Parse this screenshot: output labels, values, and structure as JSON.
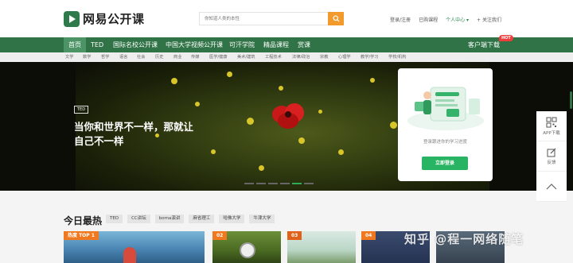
{
  "header": {
    "logo_text": "网易公开课",
    "search_placeholder": "你知道人类的本性",
    "links": [
      "登录/注册",
      "已购课程",
      "个人中心",
      "关注我们"
    ]
  },
  "nav": {
    "items": [
      "首页",
      "TED",
      "国际名校公开课",
      "中国大学视频公开课",
      "可汗学院",
      "精品课程",
      "赏课"
    ],
    "client_download": "客户端下载",
    "hot_badge": "HOT"
  },
  "subnav": {
    "items": [
      "文学",
      "数学",
      "哲学",
      "语言",
      "社会",
      "历史",
      "商业",
      "传媒",
      "医学/健康",
      "美术/建筑",
      "工程技术",
      "法律/政治",
      "宗教",
      "心理学",
      "教学/学习",
      "学校/机构"
    ]
  },
  "hero": {
    "tag": "TED",
    "title_line1": "当你和世界不一样，那就让",
    "title_line2": "自己不一样"
  },
  "login_card": {
    "text": "登录跟进你的学习进度",
    "button": "立即登录"
  },
  "side_float": {
    "app_label": "APP下载",
    "feedback_label": "反馈"
  },
  "today": {
    "title": "今日最热",
    "tags": [
      "TED",
      "CC讲坛",
      "boma演讲",
      "麻省理工",
      "哈佛大学",
      "牛津大学"
    ],
    "cards": [
      {
        "num": "热度 TOP 1"
      },
      {
        "num": "02"
      },
      {
        "num": "03"
      },
      {
        "num": "04"
      }
    ]
  },
  "watermark": "知乎 @程一网络随笔",
  "colors": {
    "brand_green": "#2f7346",
    "accent_orange": "#f39a2c",
    "login_green": "#28b462",
    "hot_red": "#ef3d3d"
  }
}
